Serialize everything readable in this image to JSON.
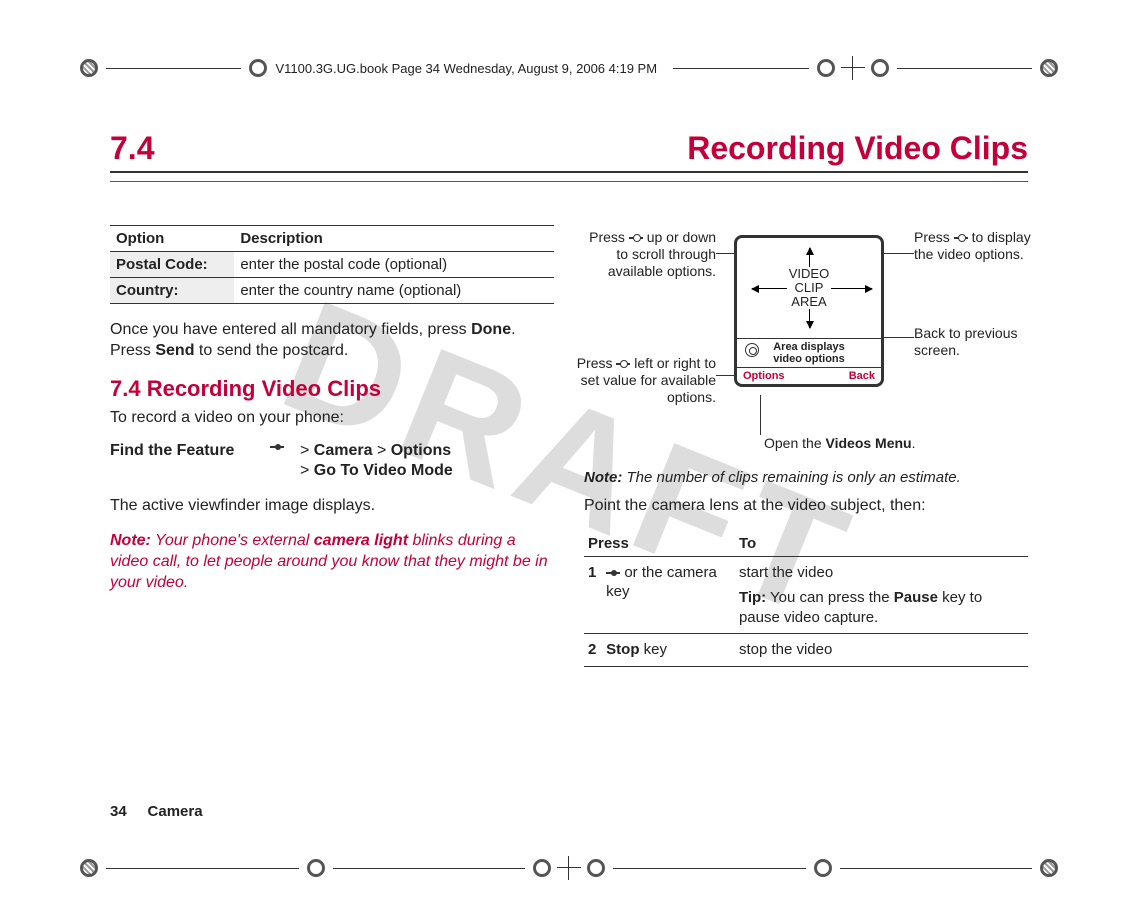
{
  "header": {
    "book_tag": "V1100.3G.UG.book  Page 34  Wednesday, August 9, 2006  4:19 PM"
  },
  "watermark": "DRAFT",
  "section": {
    "number": "7.4",
    "title": "Recording Video Clips"
  },
  "option_table": {
    "col1": "Option",
    "col2": "Description",
    "rows": [
      {
        "opt": "Postal Code:",
        "desc": "enter the postal code (optional)"
      },
      {
        "opt": "Country:",
        "desc": "enter the country name (optional)"
      }
    ]
  },
  "left": {
    "para1a": "Once you have entered all mandatory fields, press ",
    "para1_done": "Done",
    "para1b": ". Press ",
    "para1_send": "Send",
    "para1c": " to send the postcard.",
    "h2": "7.4 Recording Video Clips",
    "para2": "To record a video on your phone:",
    "find_label": "Find the Feature",
    "path1a": "> ",
    "path1_camera": "Camera",
    "path1b": " > ",
    "path1_options": "Options",
    "path2a": "> ",
    "path2_goto": "Go To Video Mode",
    "para3": "The active viewfinder image displays.",
    "note_label": "Note:",
    "note_a": " Your phone's external ",
    "note_b": "camera light",
    "note_c": " blinks during a video call, to let people around you know that they might be in your video."
  },
  "diagram": {
    "callout_topleft": "Press S up or down to scroll through available options.",
    "callout_topright": "Press S to display the video options.",
    "callout_right2": "Back to previous screen.",
    "callout_midleft": "Press S left or right to set value for available options.",
    "callout_bottom_a": "Open the ",
    "callout_bottom_b": "Videos Menu",
    "callout_bottom_c": ".",
    "clip_label": "VIDEO\nCLIP\nAREA",
    "strip_a": "Area displays",
    "strip_b": "video options",
    "soft_left": "Options",
    "soft_right": "Back"
  },
  "right": {
    "note2_label": "Note:",
    "note2_text": " The number of clips remaining is only an estimate.",
    "point_text": "Point the camera lens at the video subject, then:",
    "th_press": "Press",
    "th_to": "To",
    "r1_num": "1",
    "r1_press_a": " or the camera key",
    "r1_to_a": "start the video",
    "r1_tip_label": "Tip:",
    "r1_tip_a": " You can press the ",
    "r1_tip_pause": "Pause",
    "r1_tip_b": " key to pause video capture.",
    "r2_num": "2",
    "r2_press": "Stop",
    "r2_press_b": " key",
    "r2_to": "stop the video"
  },
  "footer": {
    "page": "34",
    "chapter": "Camera"
  }
}
